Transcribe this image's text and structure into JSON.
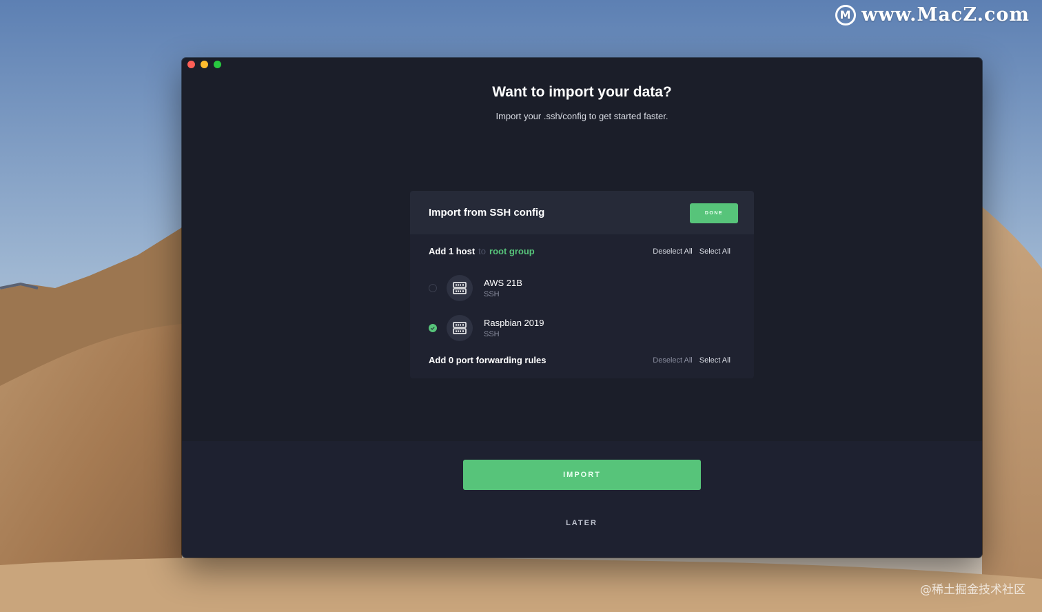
{
  "watermark": {
    "top_logo": "M",
    "top_text": "www.MacZ.com",
    "bottom_text": "@稀土掘金技术社区"
  },
  "window": {
    "title": "Want to import your data?",
    "subtitle": "Import your .ssh/config to get started faster."
  },
  "panel": {
    "title": "Import from SSH config",
    "done_label": "DONE",
    "hosts_section": {
      "lead": "Add 1 host",
      "to": "to",
      "group": "root group",
      "deselect_all": "Deselect All",
      "select_all": "Select All"
    },
    "hosts": [
      {
        "name": "AWS 21B",
        "type": "SSH",
        "selected": false,
        "icon": "server-icon"
      },
      {
        "name": "Raspbian 2019",
        "type": "SSH",
        "selected": true,
        "icon": "server-icon"
      }
    ],
    "rules_section": {
      "lead": "Add 0 port forwarding rules",
      "deselect_all": "Deselect All",
      "select_all": "Select All"
    }
  },
  "actions": {
    "import_label": "IMPORT",
    "later_label": "LATER"
  },
  "colors": {
    "accent": "#57c47a",
    "window_bg": "#1b1e29",
    "panel_bg": "#1f2230",
    "panel_header_bg": "#262a38"
  }
}
